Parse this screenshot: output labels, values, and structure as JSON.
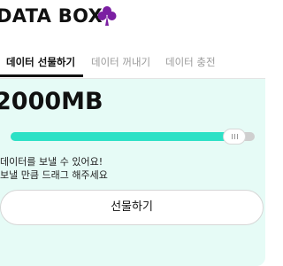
{
  "header": {
    "brand": "DATA BOX",
    "logo_icon": "clover-icon",
    "accent_color": "#7b1fa2"
  },
  "tabs": [
    {
      "label": "데이터 선물하기",
      "active": true
    },
    {
      "label": "데이터 꺼내기",
      "active": false
    },
    {
      "label": "데이터 충전",
      "active": false
    }
  ],
  "main": {
    "amount": "2000MB",
    "slider": {
      "fill_fraction": 0.96,
      "fill_color": "#2de1c6"
    },
    "hint_line1": "데이터를 보낼 수 있어요!",
    "hint_line2": "보낼 만큼 드래그 해주세요",
    "send_button_label": "선물하기",
    "panel_color": "#e6fbf6"
  }
}
